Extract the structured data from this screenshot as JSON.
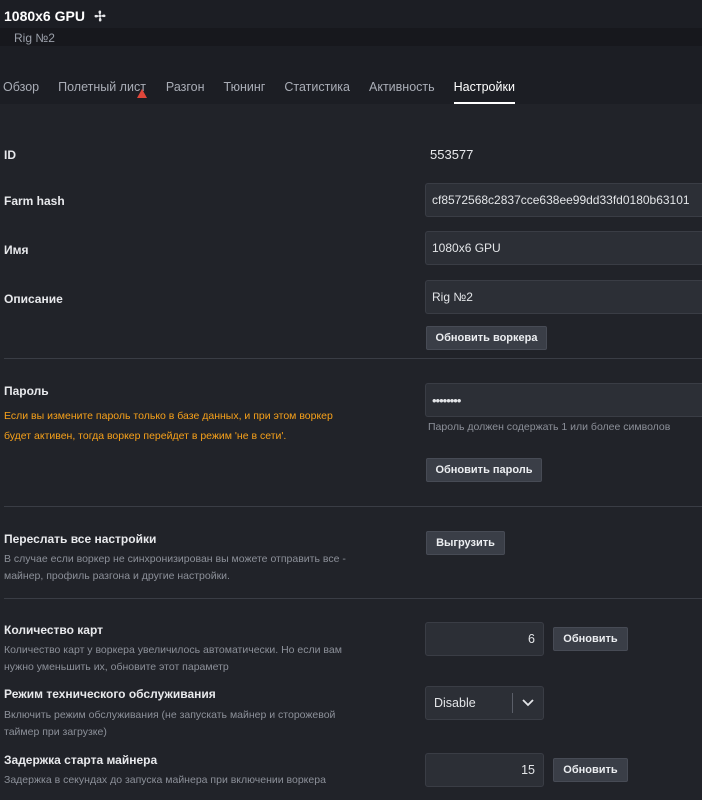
{
  "header": {
    "title": "1080x6 GPU",
    "fan_icon": "fan-icon",
    "description": "Rig №2"
  },
  "tabs": [
    {
      "label": "Обзор",
      "active": false
    },
    {
      "label": "Полетный лист",
      "active": false,
      "warning": true
    },
    {
      "label": "Разгон",
      "active": false
    },
    {
      "label": "Тюнинг",
      "active": false
    },
    {
      "label": "Статистика",
      "active": false
    },
    {
      "label": "Активность",
      "active": false
    },
    {
      "label": "Настройки",
      "active": true
    }
  ],
  "colors": {
    "accent_warning": "#e0463a",
    "hint_orange": "#f7a11a",
    "background": "#212329"
  },
  "settings": {
    "id": {
      "label": "ID",
      "value": "553577"
    },
    "farm_hash": {
      "label": "Farm hash",
      "value": "cf8572568c2837cce638ee99dd33fd0180b63101"
    },
    "name": {
      "label": "Имя",
      "value": "1080x6 GPU"
    },
    "description": {
      "label": "Описание",
      "value": "Rig №2"
    },
    "update_worker_button": "Обновить воркера",
    "password": {
      "label": "Пароль",
      "warning_line1": "Если вы измените пароль только в базе данных, и при этом воркер",
      "warning_line2": "будет активен, тогда воркер перейдет в режим 'не в сети'.",
      "value": "••••••••",
      "hint": "Пароль должен содержать 1 или более символов",
      "button": "Обновить пароль"
    },
    "resend": {
      "label": "Переслать все настройки",
      "hint_line1": "В случае если воркер не синхронизирован вы можете отправить все -",
      "hint_line2": "майнер, профиль разгона и другие настройки.",
      "button": "Выгрузить"
    },
    "gpu_count": {
      "label": "Количество карт",
      "hint_line1": "Количество карт у воркера увеличилось автоматически. Но если вам",
      "hint_line2": "нужно уменьшить их, обновите этот параметр",
      "value": "6",
      "button": "Обновить"
    },
    "maintenance": {
      "label": "Режим технического обслуживания",
      "hint_line1": "Включить режим обслуживания (не запускать майнер и сторожевой",
      "hint_line2": "таймер при загрузке)",
      "selected": "Disable"
    },
    "miner_delay": {
      "label": "Задержка старта майнера",
      "hint_line1": "Задержка в секундах до запуска майнера при включении воркера",
      "value": "15",
      "button": "Обновить"
    }
  }
}
